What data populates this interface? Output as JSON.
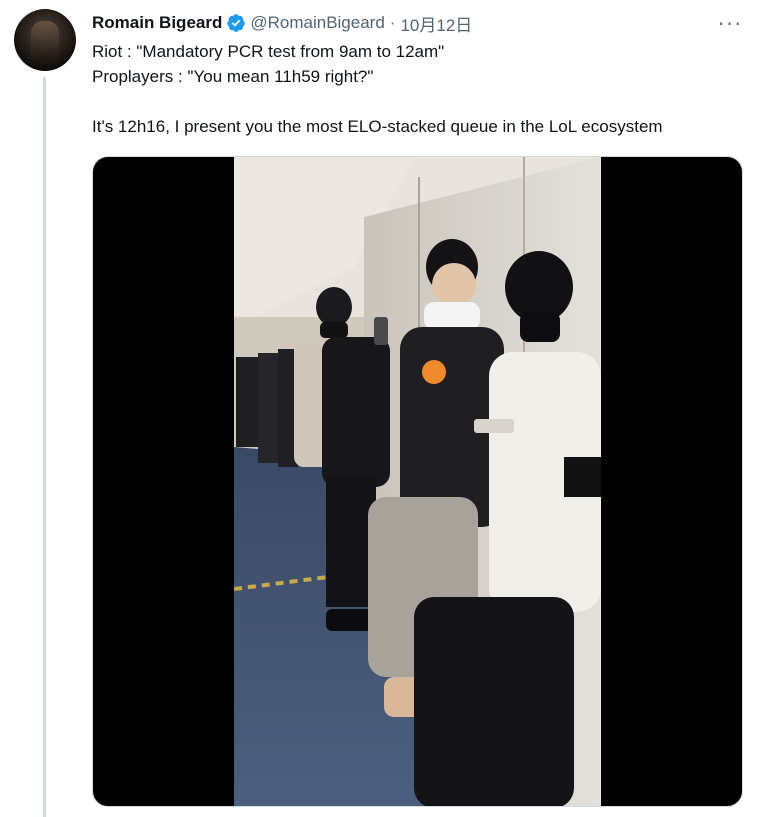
{
  "author": {
    "display_name": "Romain Bigeard",
    "handle": "@RomainBigeard",
    "date": "10月12日",
    "verified": true
  },
  "tweet": {
    "lines": [
      "Riot : \"Mandatory PCR test from 9am to 12am\"",
      "Proplayers : \"You mean 11h59 right?\"",
      "It's 12h16, I present you the most ELO-stacked queue in the LoL ecosystem"
    ]
  },
  "icons": {
    "verified": "verified-badge-icon",
    "more": "more-options-icon"
  },
  "colors": {
    "verified_blue": "#1d9bf0",
    "muted_text": "#536471",
    "thread_line": "#cfd9de"
  }
}
